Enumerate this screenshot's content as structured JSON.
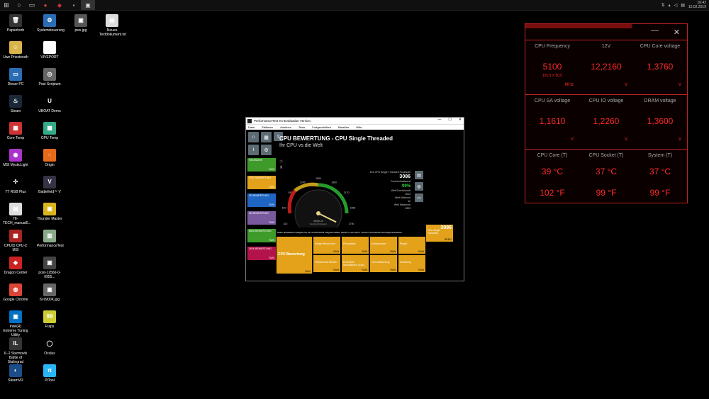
{
  "taskbar": {
    "start_icon": "windows-icon",
    "apps": [
      "search",
      "task-view",
      "chrome",
      "mystic-light",
      "folder",
      "performancetest"
    ],
    "tray_icons": [
      "network-icon",
      "notification-icon",
      "volume-icon",
      "language-icon"
    ],
    "time": "16:42",
    "date": "15.02.2019"
  },
  "desktop_icons": [
    {
      "label": "Papierkorb",
      "glyph": "🗑",
      "color": "#333"
    },
    {
      "label": "Systemsteuerung",
      "glyph": "⚙",
      "color": "#2a6db5"
    },
    {
      "label": "pwx.jpg",
      "glyph": "▣",
      "color": "#555"
    },
    {
      "label": "Neues Textdokument.txt",
      "glyph": "▤",
      "color": "#ddd"
    },
    {
      "label": "Uwe Priesterath",
      "glyph": "☺",
      "color": "#d9b44a"
    },
    {
      "label": "VIVEPORT",
      "glyph": "◭",
      "color": "#fff"
    },
    {
      "label": "Dieser PC",
      "glyph": "▭",
      "color": "#2a6db5"
    },
    {
      "label": "Post Scriptum",
      "glyph": "◎",
      "color": "#666"
    },
    {
      "label": "Steam",
      "glyph": "♨",
      "color": "#1b2838"
    },
    {
      "label": "UBOAT Demo",
      "glyph": "U",
      "color": "#000"
    },
    {
      "label": "Core Temp",
      "glyph": "▦",
      "color": "#c33"
    },
    {
      "label": "GPU Temp",
      "glyph": "▦",
      "color": "#3a8"
    },
    {
      "label": "MSI MysticLight",
      "glyph": "◉",
      "color": "#a3c"
    },
    {
      "label": "Origin",
      "glyph": "◌",
      "color": "#e66a1a"
    },
    {
      "label": "TT RGB Plus",
      "glyph": "✣",
      "color": "#000"
    },
    {
      "label": "Battlefield™ V",
      "glyph": "V",
      "color": "#334"
    },
    {
      "label": "HI-TECH_manual0...",
      "glyph": "▤",
      "color": "#ddd"
    },
    {
      "label": "Thunder Master",
      "glyph": "▣",
      "color": "#d9b41a"
    },
    {
      "label": "CPUID CPU-Z MSI",
      "glyph": "▩",
      "color": "#a22"
    },
    {
      "label": "PerformanceTest",
      "glyph": "▥",
      "color": "#8a8"
    },
    {
      "label": "Dragon Center",
      "glyph": "◆",
      "color": "#c22"
    },
    {
      "label": "post-12566-0-0955...",
      "glyph": "▣",
      "color": "#444"
    },
    {
      "label": "Google Chrome",
      "glyph": "◍",
      "color": "#db4437"
    },
    {
      "label": "i9-9900K.jpg",
      "glyph": "▣",
      "color": "#666"
    },
    {
      "label": "Intel(R) Extreme Tuning Utility",
      "glyph": "▣",
      "color": "#0071c5"
    },
    {
      "label": "Fraps",
      "glyph": "99",
      "color": "#cc3"
    },
    {
      "label": "IL-2 Sturmovik Battle of Stalingrad",
      "glyph": "IL",
      "color": "#333"
    },
    {
      "label": "Oculus",
      "glyph": "◯",
      "color": "#000"
    },
    {
      "label": "SteamVR",
      "glyph": "◐",
      "color": "#1b4e88"
    },
    {
      "label": "PiTool",
      "glyph": "π",
      "color": "#29b6f6"
    }
  ],
  "monitor": {
    "minimize": "—",
    "close": "✕",
    "row1": [
      {
        "label": "CPU Frequency",
        "value": "5100",
        "sub": "102,0 X 50,0",
        "unit": "MHz"
      },
      {
        "label": "12V",
        "value": "12,2160",
        "unit": "V"
      },
      {
        "label": "CPU Core voltage",
        "value": "1,3760",
        "unit": "V"
      }
    ],
    "row2": [
      {
        "label": "CPU SA voltage",
        "value": "1,1610",
        "unit": "V"
      },
      {
        "label": "CPU IO voltage",
        "value": "1,2260",
        "unit": "V"
      },
      {
        "label": "DRAM voltage",
        "value": "1,3600",
        "unit": "V"
      }
    ],
    "row3": [
      {
        "label": "CPU Core (T)",
        "value": "39 °C",
        "value2": "102 °F"
      },
      {
        "label": "CPU Socket (T)",
        "value": "37 °C",
        "value2": "99 °F"
      },
      {
        "label": "System (T)",
        "value": "37 °C",
        "value2": "99 °F"
      }
    ]
  },
  "pt": {
    "window_title": "PerformanceTest 9.0 Evaluation Version",
    "menu": [
      "Datei",
      "Editieren",
      "Ansehen",
      "Tests",
      "Fortgeschritten",
      "Baseline",
      "Hilfe"
    ],
    "heading": "CPU BEWERTUNG - CPU Single Threaded",
    "subheading": "Ihr CPU vs die Welt",
    "categories": [
      {
        "label": "PASSMARK",
        "run": "RUN",
        "color": "#3e9b2a"
      },
      {
        "label": "CPU BEWERTUNG",
        "run": "RUN",
        "color": "#e3a21a"
      },
      {
        "label": "2D BEWERTUNG",
        "run": "RUN",
        "color": "#1f66c4"
      },
      {
        "label": "3D BEWERTUNG",
        "run": "RUN",
        "color": "#7a5a9e"
      },
      {
        "label": "MEM BEWERTUNG",
        "run": "RUN",
        "color": "#3e9b2a"
      },
      {
        "label": "DISK BEWERTUNG",
        "run": "RUN",
        "color": "#b3124a"
      }
    ],
    "gauge": {
      "ticks": [
        "0",
        "310",
        "620",
        "930",
        "1240",
        "1550",
        "1860",
        "2170",
        "2480",
        "2790",
        "3100"
      ],
      "percent_labels": [
        "1%",
        "25%",
        "50%",
        "75%",
        "99%"
      ],
      "center_label": "MOps./s",
      "center_sub": "Durchschnittswert",
      "needle_value": 3086,
      "max": 3100
    },
    "stats": {
      "title": "Ihre CPU Single Threaded Punktzahl",
      "score": "3086",
      "perc_label": "Durchschnittswert",
      "percentile": "99%",
      "avg_label": "Welt Durchschnitt",
      "avg": "1613",
      "min_label": "Welt Minimum",
      "min": "42",
      "max_label": "Welt Maximum",
      "max": "3303"
    },
    "info_text": "Daten aktualisieren Diagramme 22.11.2018 09:03. Diagrammdaten werden in der Demo. Version nicht Aktuell nicht längerlinsiabtsen",
    "main_tile": {
      "label": "CPU Bewertung",
      "run": "RUN"
    },
    "tiles": [
      {
        "label": "Integer Berechnun",
        "run": "RUN"
      },
      {
        "label": "Primzahlen",
        "run": "RUN"
      },
      {
        "label": "Kompression",
        "run": "RUN"
      },
      {
        "label": "Physik",
        "run": "RUN"
      },
      {
        "label": "Fließkomma Berech",
        "run": "RUN"
      },
      {
        "label": "Erweiterte Instruktionen (SSE)",
        "run": "RUN"
      },
      {
        "label": "Verschlüsselung",
        "run": "RUN"
      },
      {
        "label": "Sortierung",
        "run": "RUN"
      }
    ],
    "score_tile": {
      "label": "CPU Single Threaded",
      "score": "3086",
      "run": "REDO"
    }
  }
}
